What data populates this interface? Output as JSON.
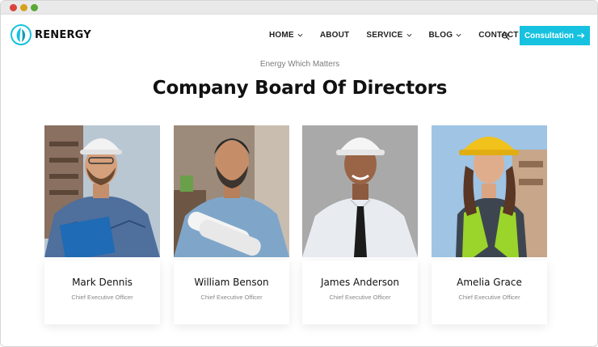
{
  "browser": {
    "window_controls": [
      "close",
      "minimize",
      "maximize"
    ]
  },
  "brand": {
    "name": "RENERGY",
    "accent": "#16c2df"
  },
  "nav": {
    "items": [
      {
        "label": "HOME",
        "dropdown": true
      },
      {
        "label": "ABOUT",
        "dropdown": false
      },
      {
        "label": "SERVICE",
        "dropdown": true
      },
      {
        "label": "BLOG",
        "dropdown": true
      },
      {
        "label": "CONTACT",
        "dropdown": false
      }
    ],
    "search_icon": "search-icon",
    "cta_label": "Consultation",
    "cta_icon": "arrow-right-icon"
  },
  "section": {
    "eyebrow": "Energy Which Matters",
    "title": "Company Board Of Directors"
  },
  "team": [
    {
      "name": "Mark Dennis",
      "role": "Chief Executive Officer"
    },
    {
      "name": "William Benson",
      "role": "Chief Executive Officer"
    },
    {
      "name": "James Anderson",
      "role": "Chief Executive Officer"
    },
    {
      "name": "Amelia Grace",
      "role": "Chief Executive Officer"
    }
  ]
}
